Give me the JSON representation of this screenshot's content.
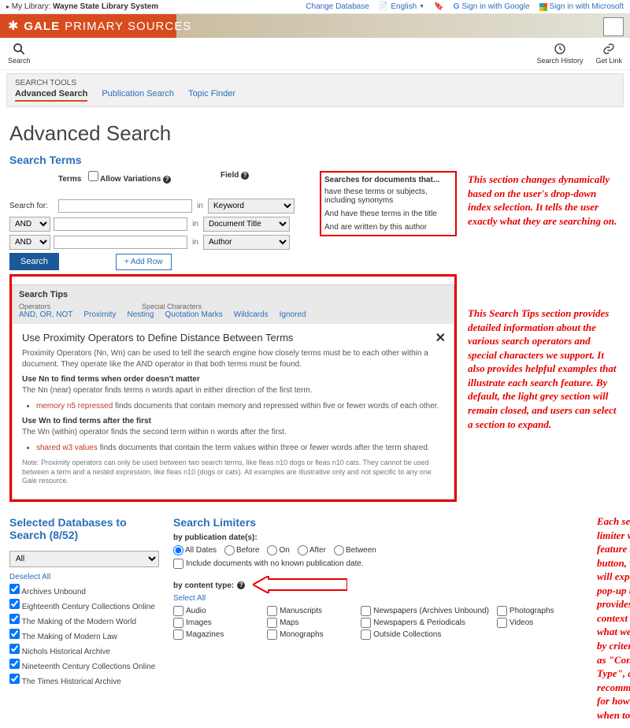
{
  "topbar": {
    "library_label": "My Library:",
    "library_name": "Wayne State Library System",
    "change_db": "Change Database",
    "language": "English",
    "signin_google": "Sign in with Google",
    "signin_ms": "Sign in with Microsoft"
  },
  "brand": {
    "b1": "GALE",
    "b2": "PRIMARY SOURCES"
  },
  "toolbar": {
    "search": "Search",
    "search_history": "Search History",
    "get_link": "Get Link"
  },
  "search_tools": {
    "heading": "SEARCH TOOLS",
    "tabs": [
      "Advanced Search",
      "Publication Search",
      "Topic Finder"
    ]
  },
  "page_title": "Advanced Search",
  "terms": {
    "section": "Search Terms",
    "h_terms": "Terms",
    "h_field": "Field",
    "h_desc": "Searches for documents that...",
    "allow": "Allow Variations",
    "search_for": "Search for:",
    "in": "in",
    "rows": [
      {
        "op": "",
        "field": "Keyword",
        "desc": "have these terms or subjects, including synonyms"
      },
      {
        "op": "AND",
        "field": "Document Title",
        "desc": "And have these terms in the title"
      },
      {
        "op": "AND",
        "field": "Author",
        "desc": "And are written by this author"
      }
    ],
    "btn_search": "Search",
    "btn_addrow": "+ Add Row"
  },
  "tips": {
    "title": "Search Tips",
    "label_ops": "Operators",
    "label_special": "Special Characters",
    "links": [
      "AND, OR, NOT",
      "Proximity",
      "Nesting",
      "Quotation Marks",
      "Wildcards",
      "Ignored"
    ],
    "body_title": "Use Proximity Operators to Define Distance Between Terms",
    "p1": "Proximity Operators (Nn, Wn) can be used to tell the search engine how closely terms must be to each other within a document. They operate like the AND operator in that both terms must be found.",
    "sub1": "Use Nn to find terms when order doesn't matter",
    "p2a": "The Nn (near) operator finds terms n words apart in either direction of the first term.",
    "ex1a": "memory n5 repressed",
    "ex1b": " finds documents that contain memory and repressed within five or fewer words of each other.",
    "sub2": "Use Wn to find terms after the first",
    "p3a": "The Wn (within) operator finds the second term within n words after the first.",
    "ex2a": "shared w3 values",
    "ex2b": " finds documents that contain the term values within three or fewer words after the term shared.",
    "note": "Note: Proximity operators can only be used between two search terms, like fleas n10 dogs or fleas n10 cats. They cannot be used between a term and a nested expression, like fleas n10 (dogs or cats). All examples are illustrative only and not specific to any one Gale resource."
  },
  "annotations": {
    "a1": "This section changes dynamically based on the user's drop-down index selection. It tells the user exactly what they are searching on.",
    "a2": "This Search Tips section provides detailed information about the various search operators and special characters we support. It also provides helpful examples that illustrate each search feature. By default, the light grey section will remain closed, and users can select a section to expand.",
    "a3": "Each search limiter will also feature an \"info\" button, which will expand to a pop-up that provides more context about what we \"mean\" by criteria such as \"Content Type\", as well as recommendations for how and when to use it."
  },
  "databases": {
    "heading": "Selected Databases to Search (8/52)",
    "all": "All",
    "deselect": "Deselect All",
    "items": [
      "Archives Unbound",
      "Eighteenth Century Collections Online",
      "The Making of the Modern World",
      "The Making of Modern Law",
      "Nichols Historical Archive",
      "Nineteenth Century Collections Online",
      "The Times Historical Archive"
    ]
  },
  "limiters": {
    "heading": "Search Limiters",
    "pub_label": "by publication date(s):",
    "dates": [
      "All Dates",
      "Before",
      "On",
      "After",
      "Between"
    ],
    "include": "Include documents with no known publication date.",
    "ct_label": "by content type:",
    "select_all": "Select All",
    "types": [
      "Audio",
      "Manuscripts",
      "Newspapers (Archives Unbound)",
      "Photographs",
      "Images",
      "Maps",
      "Newspapers & Periodicals",
      "Videos",
      "Magazines",
      "Monographs",
      "Outside Collections",
      ""
    ]
  }
}
